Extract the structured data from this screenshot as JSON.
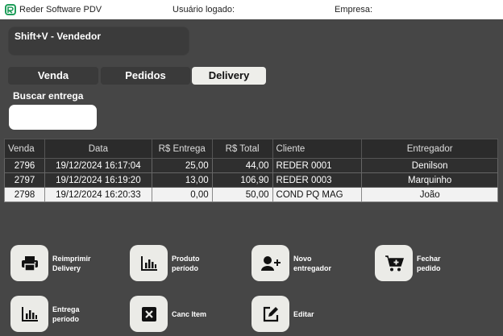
{
  "titlebar": {
    "app_name": "Reder Software PDV",
    "user_label": "Usuário logado:",
    "company_label": "Empresa:"
  },
  "vendor": {
    "label": "Shift+V - Vendedor"
  },
  "tabs": [
    {
      "label": "Venda"
    },
    {
      "label": "Pedidos"
    },
    {
      "label": "Delivery"
    }
  ],
  "search": {
    "label": "Buscar entrega",
    "value": ""
  },
  "table": {
    "headers": [
      "Venda",
      "Data",
      "R$ Entrega",
      "R$ Total",
      "Cliente",
      "Entregador"
    ],
    "rows": [
      [
        "2796",
        "19/12/2024 16:17:04",
        "25,00",
        "44,00",
        "REDER 0001",
        "Denilson"
      ],
      [
        "2797",
        "19/12/2024 16:19:20",
        "13,00",
        "106,90",
        "REDER 0003",
        "Marquinho"
      ],
      [
        "2798",
        "19/12/2024 16:20:33",
        "0,00",
        "50,00",
        "COND PQ MAG",
        "João"
      ]
    ]
  },
  "actions": {
    "reprint": "Reimprimir Delivery",
    "product_period": "Produto período",
    "new_courier": "Novo entregador",
    "close_order": "Fechar pedido",
    "delivery_period": "Entrega período",
    "cancel_item": "Canc Item",
    "edit": "Editar"
  },
  "colors": {
    "background": "#464646",
    "button": "#ebebe7",
    "logo": "#1f9d5a"
  }
}
